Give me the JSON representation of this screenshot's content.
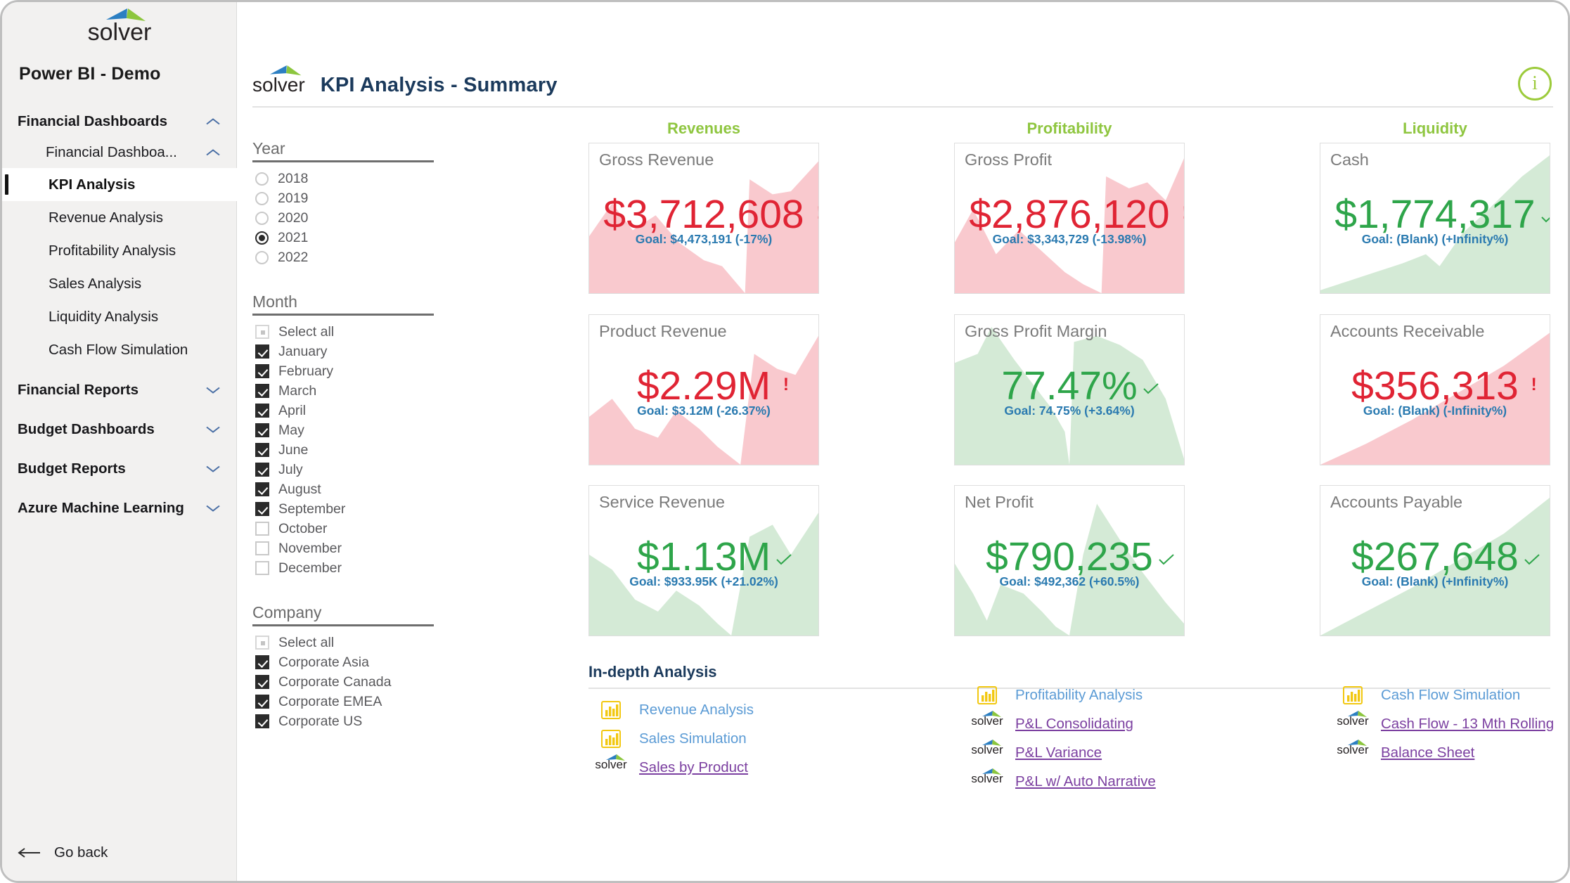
{
  "brand": {
    "name": "solver"
  },
  "sidebar": {
    "app_title": "Power BI  - Demo",
    "groups": [
      {
        "label": "Financial Dashboards",
        "chevron": "chevron-up-icon"
      },
      {
        "label": "Financial Dashboa...",
        "chevron": "chevron-up-icon"
      }
    ],
    "leaf_items": [
      {
        "label": "KPI Analysis",
        "active": true
      },
      {
        "label": "Revenue Analysis",
        "active": false
      },
      {
        "label": "Profitability Analysis",
        "active": false
      },
      {
        "label": "Sales Analysis",
        "active": false
      },
      {
        "label": "Liquidity Analysis",
        "active": false
      },
      {
        "label": "Cash Flow Simulation",
        "active": false
      }
    ],
    "collapsed_groups": [
      {
        "label": "Financial Reports",
        "chevron": "chevron-down-icon"
      },
      {
        "label": "Budget Dashboards",
        "chevron": "chevron-down-icon"
      },
      {
        "label": "Budget Reports",
        "chevron": "chevron-down-icon"
      },
      {
        "label": "Azure Machine Learning",
        "chevron": "chevron-down-icon"
      }
    ],
    "go_back": "Go back"
  },
  "header": {
    "page_title": "KPI Analysis - Summary",
    "info_icon": "info-icon",
    "info_glyph": "i"
  },
  "filters": {
    "year": {
      "title": "Year",
      "options": [
        {
          "label": "2018",
          "selected": false
        },
        {
          "label": "2019",
          "selected": false
        },
        {
          "label": "2020",
          "selected": false
        },
        {
          "label": "2021",
          "selected": true
        },
        {
          "label": "2022",
          "selected": false
        }
      ]
    },
    "month": {
      "title": "Month",
      "select_all": {
        "label": "Select all",
        "state": "partial"
      },
      "options": [
        {
          "label": "January",
          "checked": true
        },
        {
          "label": "February",
          "checked": true
        },
        {
          "label": "March",
          "checked": true
        },
        {
          "label": "April",
          "checked": true
        },
        {
          "label": "May",
          "checked": true
        },
        {
          "label": "June",
          "checked": true
        },
        {
          "label": "July",
          "checked": true
        },
        {
          "label": "August",
          "checked": true
        },
        {
          "label": "September",
          "checked": true
        },
        {
          "label": "October",
          "checked": false
        },
        {
          "label": "November",
          "checked": false
        },
        {
          "label": "December",
          "checked": false
        }
      ]
    },
    "company": {
      "title": "Company",
      "select_all": {
        "label": "Select all",
        "state": "partial"
      },
      "options": [
        {
          "label": "Corporate Asia",
          "checked": true
        },
        {
          "label": "Corporate Canada",
          "checked": true
        },
        {
          "label": "Corporate EMEA",
          "checked": true
        },
        {
          "label": "Corporate US",
          "checked": true
        }
      ]
    }
  },
  "columns": [
    {
      "label": "Revenues"
    },
    {
      "label": "Profitability"
    },
    {
      "label": "Liquidity"
    }
  ],
  "colors": {
    "accent_green": "#8fc640",
    "kpi_bad": "#e02434",
    "kpi_good": "#2ea54a",
    "goal_blue": "#2a7ab0",
    "title_navy": "#1b3a5c",
    "link_blue": "#5b9bd5",
    "link_purple": "#7b3fa0",
    "area_red": "#f9c9ce",
    "area_green": "#d4ead6"
  },
  "kpis": [
    {
      "title": "Gross Revenue",
      "value": "$3,712,608",
      "goal": "Goal: $4,473,191 (-17%)",
      "status": "bad",
      "indicator": "!",
      "col": 0,
      "row": 0,
      "spark": "0,62 10,40 19,58 29,48 39,66 50,78 58,82 68,100 70,24 80,34 88,32 100,12"
    },
    {
      "title": "Product Revenue",
      "value": "$2.29M",
      "goal": "Goal: $3.12M (-26.37%)",
      "status": "bad",
      "indicator": "!",
      "col": 0,
      "row": 1,
      "spark": "0,68 10,56 20,76 30,82 38,64 48,76 56,88 66,100 72,26 82,36 90,40 100,14"
    },
    {
      "title": "Service Revenue",
      "value": "$1.13M",
      "goal": "Goal: $933.95K (+21.02%)",
      "status": "good",
      "indicator": "check",
      "col": 0,
      "row": 2,
      "spark": "0,46 10,56 20,76 30,84 38,70 48,80 56,92 62,100 70,34 80,26 88,46 100,18"
    },
    {
      "title": "Gross Profit",
      "value": "$2,876,120",
      "goal": "Goal: $3,343,729 (-13.98%)",
      "status": "bad",
      "indicator": "!",
      "col": 1,
      "row": 0,
      "spark": "0,66 8,44 18,74 28,58 38,72 48,86 56,94 64,100 66,22 76,30 84,26 92,38 100,10"
    },
    {
      "title": "Gross Profit Margin",
      "value": "77.47%",
      "goal": "Goal: 74.75% (+3.64%)",
      "status": "good",
      "indicator": "check",
      "col": 1,
      "row": 1,
      "spark": "0,32 10,26 16,8 26,30 34,46 42,62 48,78 50,100 52,18 62,14 72,20 82,30 92,56 100,96"
    },
    {
      "title": "Net Profit",
      "value": "$790,235",
      "goal": "Goal: $492,362 (+60.5%)",
      "status": "good",
      "indicator": "check",
      "col": 1,
      "row": 2,
      "spark": "0,52 8,72 14,90 20,66 30,72 38,84 44,94 50,100 56,46 62,12 72,36 82,58 92,78 100,92"
    },
    {
      "title": "Cash",
      "value": "$1,774,317",
      "goal": "Goal: (Blank) (+Infinity%)",
      "status": "good",
      "indicator": "check",
      "col": 2,
      "row": 0,
      "spark": "0,98 12,92 24,86 36,80 46,74 52,82 62,60 72,46 80,34 88,22 100,8"
    },
    {
      "title": "Accounts Receivable",
      "value": "$356,313",
      "goal": "Goal: (Blank) (-Infinity%)",
      "status": "bad",
      "indicator": "!",
      "col": 2,
      "row": 1,
      "spark": "0,100 20,86 40,70 60,52 80,34 100,12"
    },
    {
      "title": "Accounts Payable",
      "value": "$267,648",
      "goal": "Goal: (Blank) (+Infinity%)",
      "status": "good",
      "indicator": "check",
      "col": 2,
      "row": 2,
      "spark": "0,100 20,84 40,68 60,50 80,32 100,8"
    }
  ],
  "indepth": {
    "title": "In-depth Analysis",
    "columns": [
      {
        "links": [
          {
            "label": "Revenue Analysis",
            "icon": "powerbi-icon",
            "style": "blue"
          },
          {
            "label": "Sales Simulation",
            "icon": "powerbi-icon",
            "style": "blue"
          },
          {
            "label": "Sales by Product",
            "icon": "solver-icon",
            "style": "purple"
          }
        ]
      },
      {
        "links": [
          {
            "label": "Profitability Analysis",
            "icon": "powerbi-icon",
            "style": "blue"
          },
          {
            "label": "P&L Consolidating",
            "icon": "solver-icon",
            "style": "purple"
          },
          {
            "label": "P&L Variance",
            "icon": "solver-icon",
            "style": "purple"
          },
          {
            "label": "P&L w/ Auto Narrative",
            "icon": "solver-icon",
            "style": "purple"
          }
        ]
      },
      {
        "links": [
          {
            "label": "Cash Flow Simulation",
            "icon": "powerbi-icon",
            "style": "blue"
          },
          {
            "label": "Cash Flow - 13 Mth Rolling",
            "icon": "solver-icon",
            "style": "purple"
          },
          {
            "label": "Balance Sheet",
            "icon": "solver-icon",
            "style": "purple"
          }
        ]
      }
    ]
  }
}
